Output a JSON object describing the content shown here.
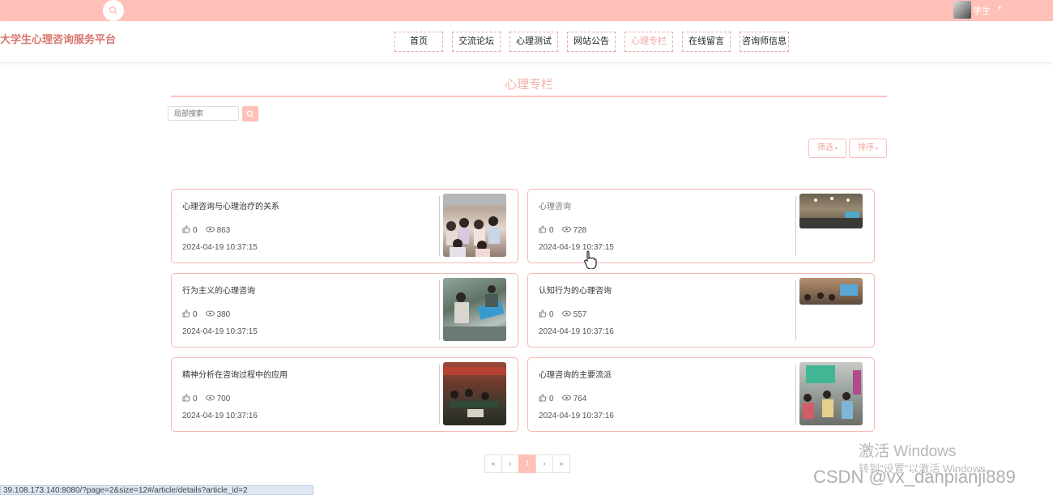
{
  "topbar": {
    "user_label": "学生",
    "user_caret": "▾"
  },
  "site": {
    "title": "大学生心理咨询服务平台"
  },
  "nav": [
    {
      "label": "首页"
    },
    {
      "label": "交流论坛"
    },
    {
      "label": "心理测试"
    },
    {
      "label": "网站公告"
    },
    {
      "label": "心理专栏"
    },
    {
      "label": "在线留言"
    },
    {
      "label": "咨询师信息"
    }
  ],
  "nav_active_index": 4,
  "section": {
    "title": "心理专栏"
  },
  "search": {
    "placeholder": "局部搜索"
  },
  "toolbar": {
    "filter_label": "筛选",
    "sort_label": "排序"
  },
  "articles": [
    {
      "title": "心理咨询与心理治疗的关系",
      "likes": "0",
      "views": "863",
      "date": "2024-04-19 10:37:15"
    },
    {
      "title": "心理咨询",
      "likes": "0",
      "views": "728",
      "date": "2024-04-19 10:37:15"
    },
    {
      "title": "行为主义的心理咨询",
      "likes": "0",
      "views": "380",
      "date": "2024-04-19 10:37:15"
    },
    {
      "title": "认知行为的心理咨询",
      "likes": "0",
      "views": "557",
      "date": "2024-04-19 10:37:16"
    },
    {
      "title": "精神分析在咨询过程中的应用",
      "likes": "0",
      "views": "700",
      "date": "2024-04-19 10:37:16"
    },
    {
      "title": "心理咨询的主要流派",
      "likes": "0",
      "views": "764",
      "date": "2024-04-19 10:37:16"
    }
  ],
  "pagination": {
    "first": "«",
    "prev": "‹",
    "current": "1",
    "next": "›",
    "last": "»"
  },
  "watermark": {
    "line1": "激活 Windows",
    "line2": "转到\"设置\"以激活 Windows。",
    "csdn": "CSDN @vx_danpianji889"
  },
  "status_bar": {
    "url": "39.108.173.140:8080/?page=2&size=12#/article/details?article_id=2"
  },
  "colors": {
    "accent": "#ffc0b8",
    "title": "#d8766e",
    "border": "#f6b8b2"
  }
}
